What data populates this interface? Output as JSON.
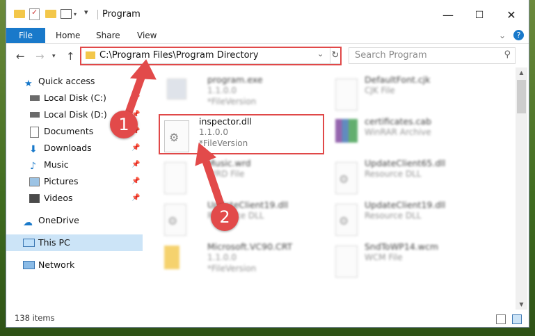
{
  "window": {
    "title": "Program",
    "controls": {
      "minimize": "—",
      "maximize": "☐",
      "close": "✕"
    }
  },
  "ribbon": {
    "tabs": [
      "File",
      "Home",
      "Share",
      "View"
    ],
    "help": "?",
    "expand": "⌄"
  },
  "address": {
    "path": "C:\\Program Files\\Program Directory",
    "search_placeholder": "Search Program"
  },
  "nav": {
    "quick_access": "Quick access",
    "items": [
      {
        "label": "Local Disk (C:)",
        "icon": "drive-icon"
      },
      {
        "label": "Local Disk (D:)",
        "icon": "drive-icon"
      },
      {
        "label": "Documents",
        "icon": "documents-icon"
      },
      {
        "label": "Downloads",
        "icon": "downloads-icon"
      },
      {
        "label": "Music",
        "icon": "music-icon"
      },
      {
        "label": "Pictures",
        "icon": "pictures-icon"
      },
      {
        "label": "Videos",
        "icon": "videos-icon"
      }
    ],
    "onedrive": "OneDrive",
    "this_pc": "This PC",
    "network": "Network"
  },
  "files": [
    {
      "name": "program.exe",
      "line2": "1.1.0.0",
      "line3": "*FileVersion"
    },
    {
      "name": "DefaultFont.cjk",
      "line2": "CJK File",
      "line3": ""
    },
    {
      "name": "inspector.dll",
      "line2": "1.1.0.0",
      "line3": "*FileVersion"
    },
    {
      "name": "certificates.cab",
      "line2": "WinRAR Archive",
      "line3": ""
    },
    {
      "name": "Music.wrd",
      "line2": "WRD File",
      "line3": ""
    },
    {
      "name": "UpdateClient65.dll",
      "line2": "Resource DLL",
      "line3": ""
    },
    {
      "name": "UpdateClient19.dll",
      "line2": "Resource DLL",
      "line3": ""
    },
    {
      "name": "UpdateClient19.dll",
      "line2": "Resource DLL",
      "line3": ""
    },
    {
      "name": "Microsoft.VC90.CRT",
      "line2": "1.1.0.0",
      "line3": "*FileVersion"
    },
    {
      "name": "SndToWP14.wcm",
      "line2": "WCM File",
      "line3": ""
    }
  ],
  "status": {
    "items_count": "138 items"
  },
  "annotations": {
    "step1": "1",
    "step2": "2",
    "highlight_color": "#e04848"
  }
}
